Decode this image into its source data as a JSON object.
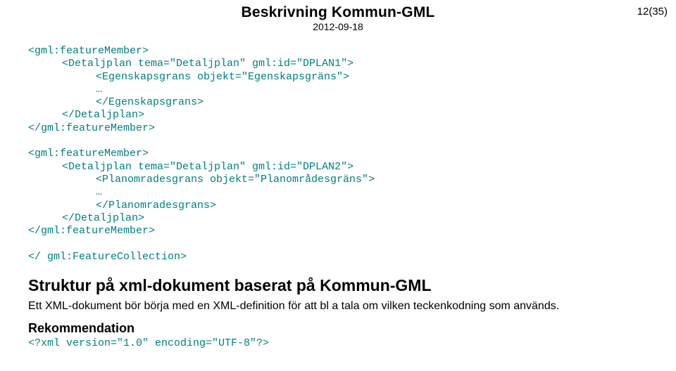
{
  "header": {
    "title": "Beskrivning Kommun-GML",
    "date": "2012-09-18",
    "page_number": "12(35)"
  },
  "code_block": {
    "l01": "<gml:featureMember>",
    "l02": "<Detaljplan tema=\"Detaljplan\" gml:id=\"DPLAN1\">",
    "l03": "<Egenskapsgrans objekt=\"Egenskapsgräns\">",
    "l04": "…",
    "l05": "</Egenskapsgrans>",
    "l06": "</Detaljplan>",
    "l07": "</gml:featureMember>",
    "l08": "",
    "l09": "<gml:featureMember>",
    "l10": "<Detaljplan tema=\"Detaljplan\" gml:id=\"DPLAN2\">",
    "l11": "<Planomradesgrans objekt=\"Planområdesgräns\">",
    "l12": "…",
    "l13": "</Planomradesgrans>",
    "l14": "</Detaljplan>",
    "l15": "</gml:featureMember>",
    "l16": "",
    "l17": "</ gml:FeatureCollection>"
  },
  "section": {
    "heading": "Struktur på xml-dokument baserat på Kommun-GML",
    "paragraph": "Ett XML-dokument bör börja med en XML-definition för att bl a tala om vilken teckenkodning som används."
  },
  "recommendation": {
    "heading": "Rekommendation",
    "code": "<?xml version=\"1.0\" encoding=\"UTF-8\"?>"
  }
}
